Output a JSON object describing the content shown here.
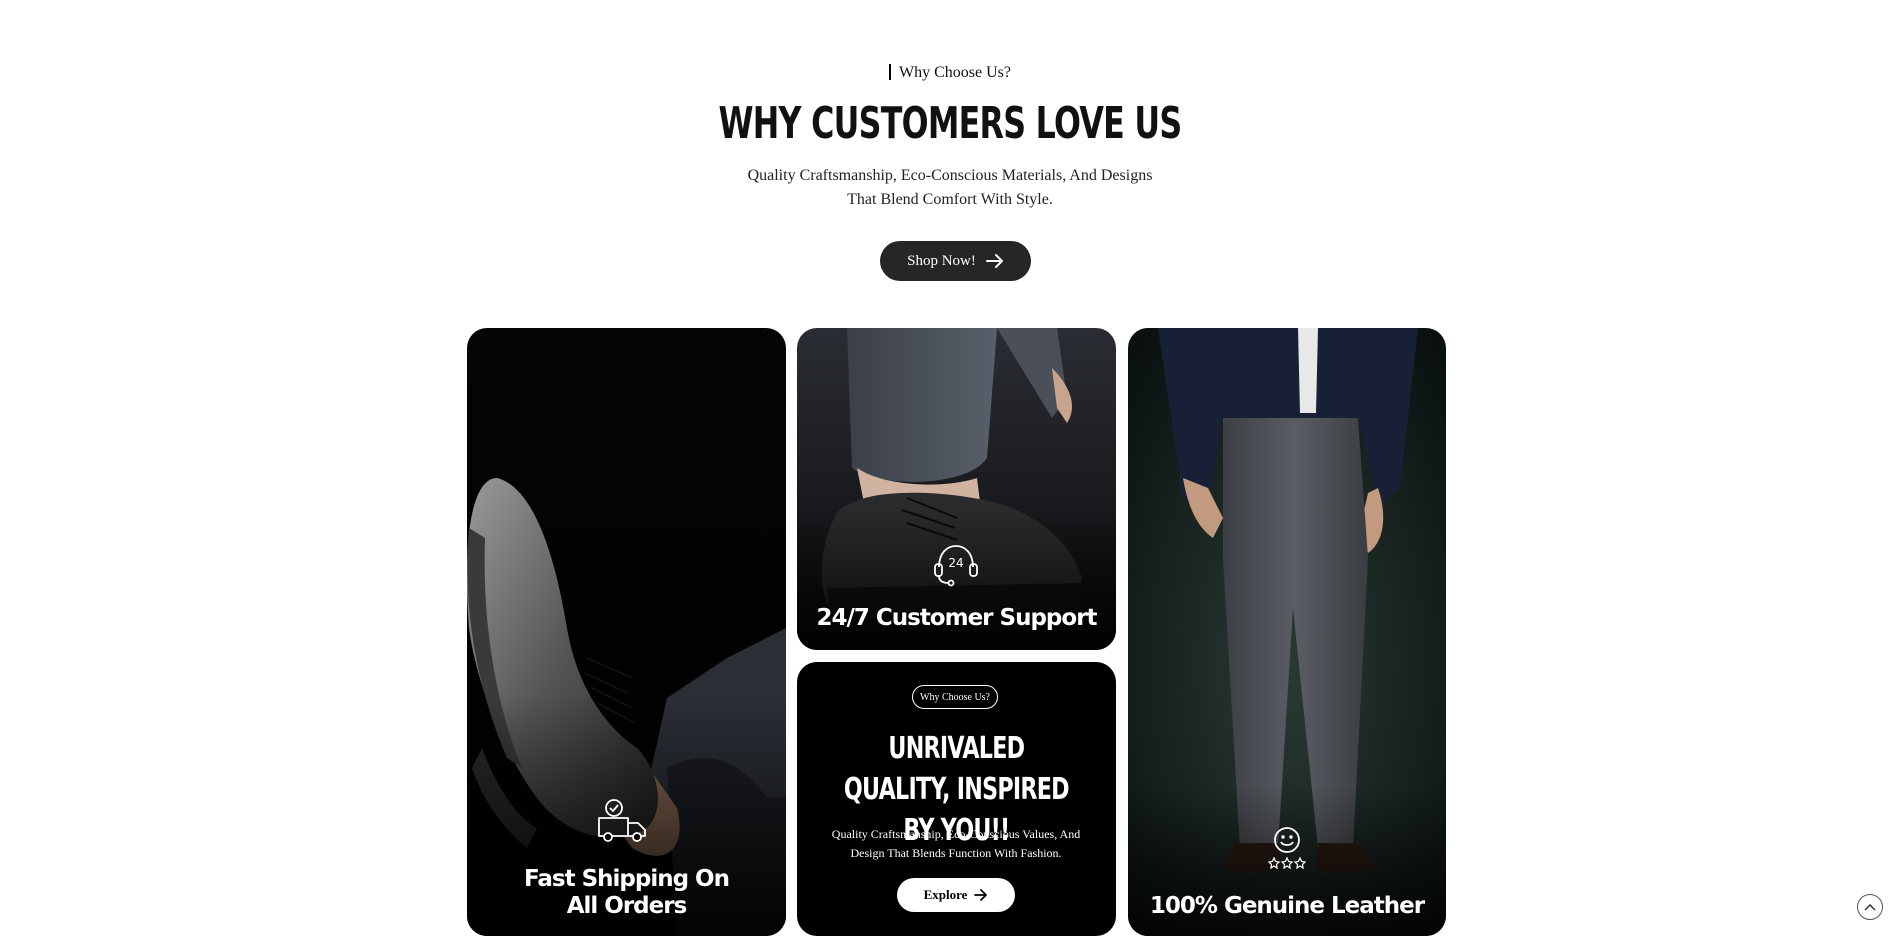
{
  "section": {
    "eyebrow": "Why Choose Us?",
    "headline": "WHY CUSTOMERS LOVE US",
    "subtext": "Quality Craftsmanship, Eco-Conscious Materials, And Designs That Blend Comfort With Style.",
    "cta_label": "Shop Now!"
  },
  "cards": {
    "shipping": {
      "title": "Fast Shipping On All Orders",
      "icon": "delivery-truck-icon"
    },
    "support": {
      "title": "24/7 Customer Support",
      "icon": "headset-24-icon",
      "icon_text": "24"
    },
    "quality": {
      "eyebrow": "Why Choose Us?",
      "title": "UNRIVALED QUALITY, INSPIRED BY YOU!!",
      "text": "Quality Craftsmanship, Eco-Conscious Values, And Design That Blends Function With Fashion.",
      "cta_label": "Explore"
    },
    "leather": {
      "title": "100% Genuine Leather",
      "icon": "smile-stars-icon"
    }
  },
  "colors": {
    "button_dark": "#262626",
    "card_bg": "#000000",
    "text_white": "#ffffff"
  }
}
